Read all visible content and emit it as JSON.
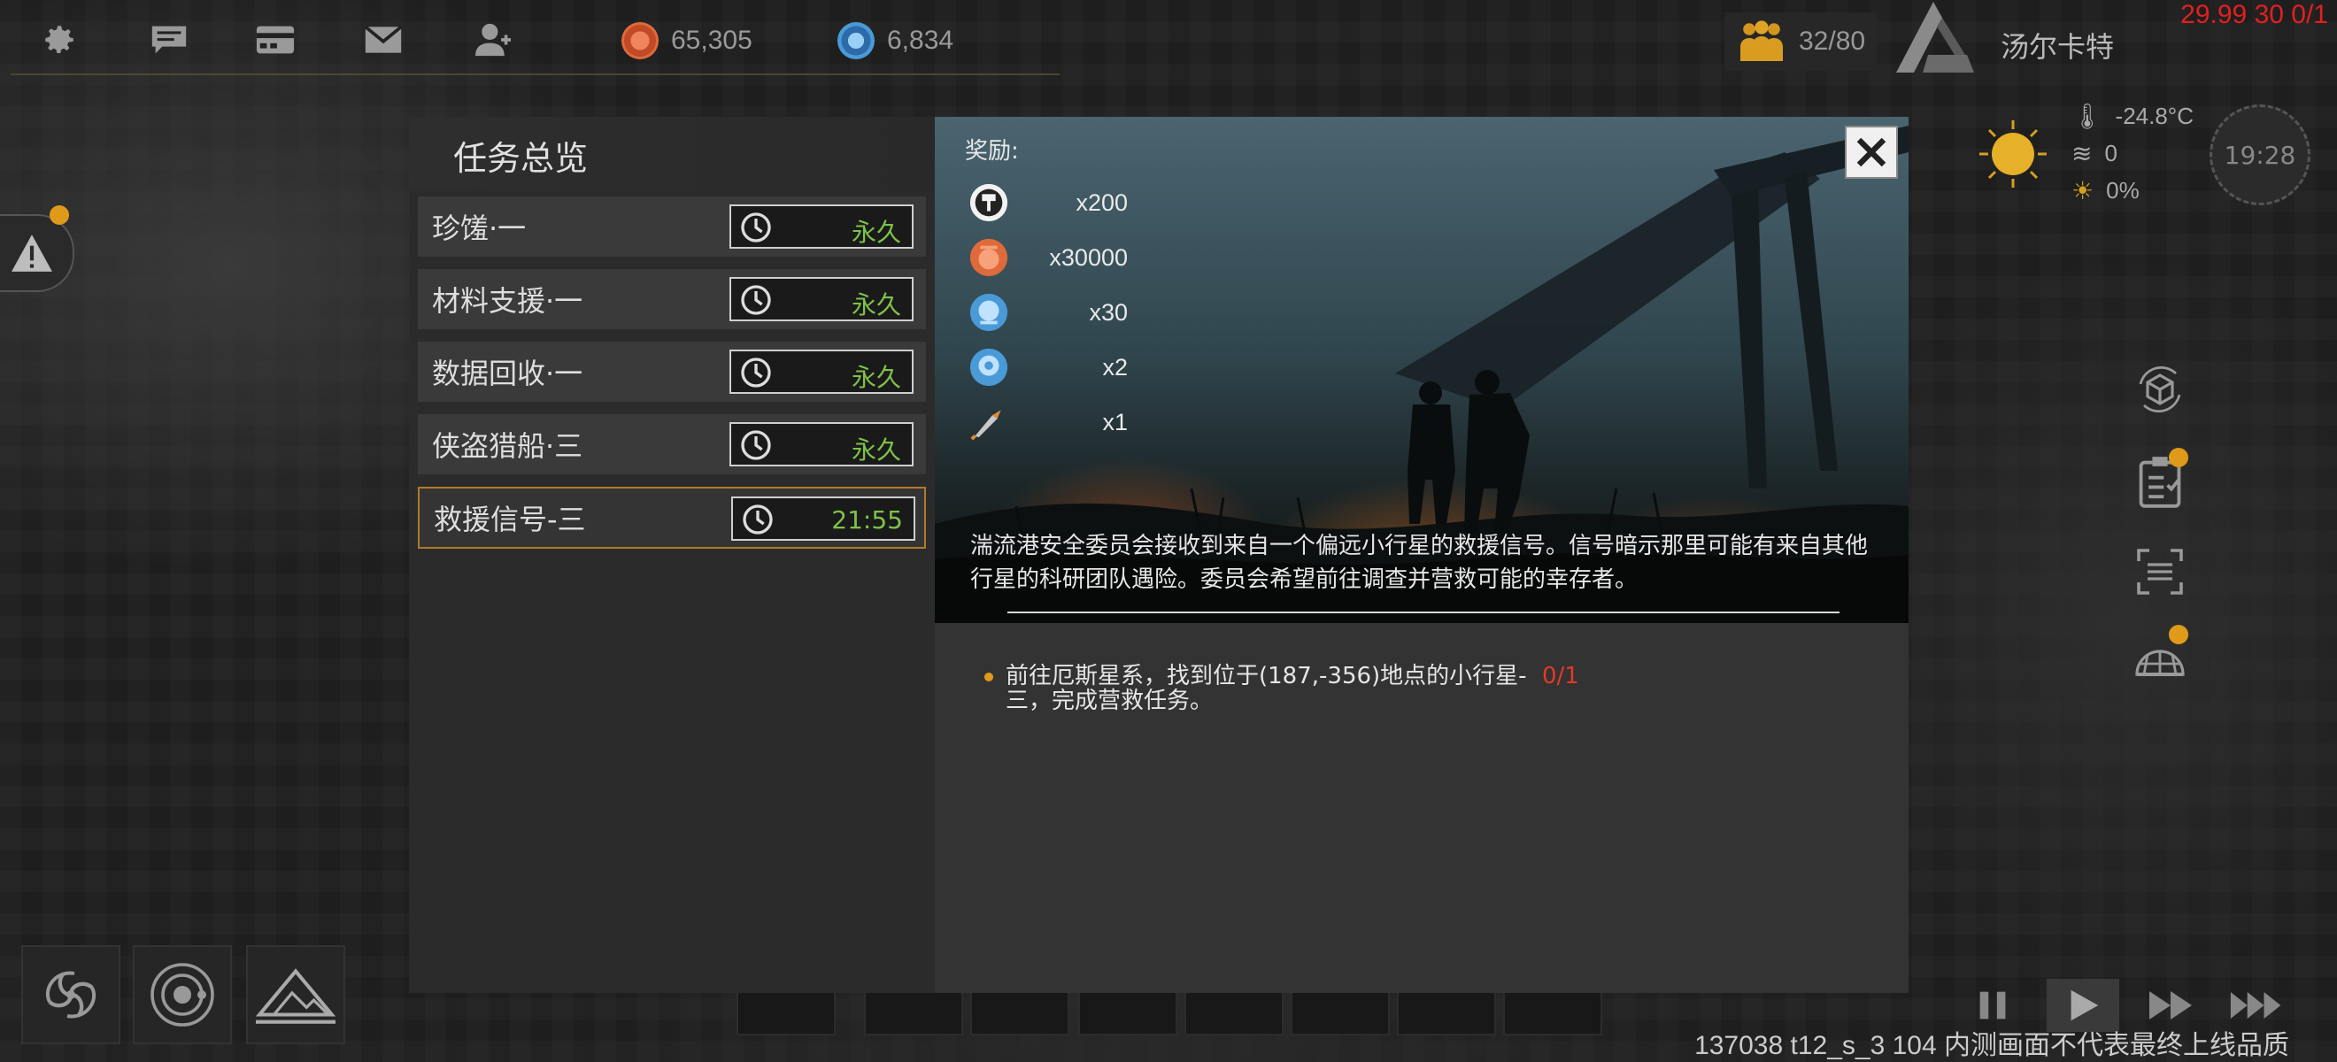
{
  "top_bar": {
    "icons": [
      "gear-icon",
      "chat-icon",
      "card-icon",
      "mail-icon",
      "contacts-icon"
    ],
    "resources": [
      {
        "icon": "red-crystal-resource-icon",
        "value": "65,305",
        "color": "#e06a3a"
      },
      {
        "icon": "blue-gem-resource-icon",
        "value": "6,834",
        "color": "#4a9ad8"
      }
    ],
    "population": "32/80",
    "player_name": "汤尔卡特",
    "debug_fps": "29.99 30 0/1"
  },
  "weather": {
    "temperature": "-24.8°C",
    "wind": "0",
    "sunlight": "0%",
    "time": "19:28"
  },
  "task_panel": {
    "title": "任务总览",
    "tasks": [
      {
        "name": "珍馐·一",
        "timer": "永久",
        "selected": false
      },
      {
        "name": "材料支援·一",
        "timer": "永久",
        "selected": false
      },
      {
        "name": "数据回收·一",
        "timer": "永久",
        "selected": false
      },
      {
        "name": "侠盗猎船·三",
        "timer": "永久",
        "selected": false
      },
      {
        "name": "救援信号-三",
        "timer": "21:55",
        "selected": true
      }
    ]
  },
  "detail": {
    "rewards_label": "奖励:",
    "rewards": [
      {
        "icon": "badge-icon",
        "quantity": "x200"
      },
      {
        "icon": "red-crystal-resource-icon",
        "quantity": "x30000"
      },
      {
        "icon": "blue-gem-resource-icon",
        "quantity": "x30"
      },
      {
        "icon": "blue-token-icon",
        "quantity": "x2"
      },
      {
        "icon": "rocket-item-icon",
        "quantity": "x1"
      }
    ],
    "description": "湍流港安全委员会接收到来自一个偏远小行星的救援信号。信号暗示那里可能有来自其他行星的科研团队遇险。委员会希望前往调查并营救可能的幸存者。",
    "objective_text": "前往厄斯星系，找到位于(187,-356)地点的小行星-三，完成营救任务。",
    "objective_progress": "0/1"
  },
  "build_info": "137038 t12_s_3 104  内测画面不代表最终上线品质",
  "colors": {
    "accent_orange": "#e09a1a",
    "timer_green": "#7fc24a",
    "progress_red": "#e03a2a"
  }
}
